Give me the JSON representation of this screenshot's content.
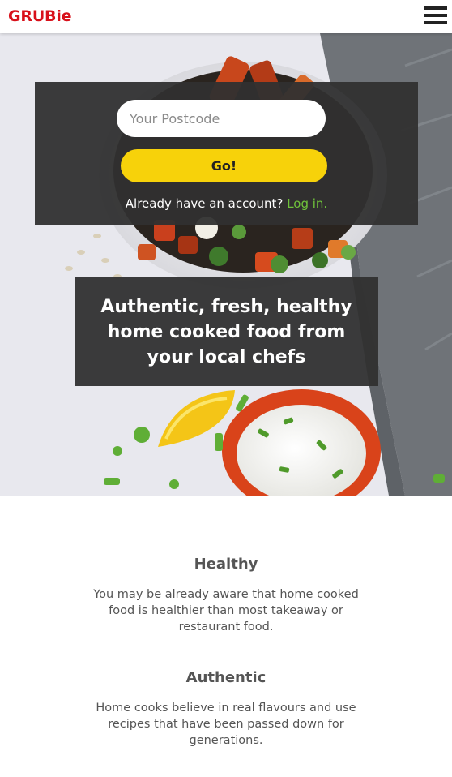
{
  "header": {
    "logo": "GRUBie",
    "menu_icon": "hamburger-menu-icon"
  },
  "login_box": {
    "postcode_placeholder": "Your Postcode",
    "postcode_value": "",
    "go_label": "Go!",
    "account_prompt": "Already have an account?",
    "login_link": "Log in."
  },
  "hero": {
    "tagline": "Authentic, fresh, healthy home cooked food from your local chefs"
  },
  "features": [
    {
      "title": "Healthy",
      "text": "You may be already aware that home cooked food is healthier than most takeaway or restaurant food."
    },
    {
      "title": "Authentic",
      "text": "Home cooks believe in real flavours and use recipes that have been passed down for generations."
    }
  ],
  "colors": {
    "brand": "#d8101a",
    "button": "#f7d20a",
    "link": "#6fc33b",
    "overlay": "#303030",
    "body_text": "#555555"
  }
}
